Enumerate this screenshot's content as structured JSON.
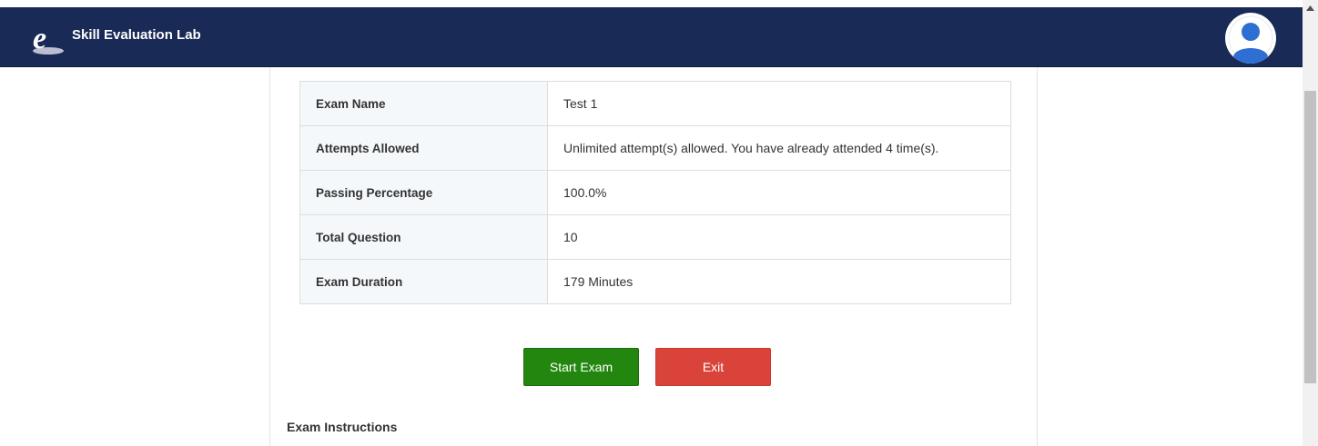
{
  "app": {
    "brand": "Skill Evaluation Lab",
    "logo_icon": "e-logo-icon",
    "avatar_icon": "user-avatar-icon"
  },
  "exam_info": {
    "rows": [
      {
        "label": "Exam Name",
        "value": "Test 1"
      },
      {
        "label": "Attempts Allowed",
        "value": "Unlimited attempt(s) allowed. You have already attended 4 time(s)."
      },
      {
        "label": "Passing Percentage",
        "value": "100.0%"
      },
      {
        "label": "Total Question",
        "value": "10"
      },
      {
        "label": "Exam Duration",
        "value": "179 Minutes"
      }
    ]
  },
  "actions": {
    "start_label": "Start Exam",
    "exit_label": "Exit"
  },
  "instructions": {
    "heading": "Exam Instructions"
  },
  "colors": {
    "navbar": "#1a2a57",
    "start_button": "#23870f",
    "exit_button": "#d9433a"
  }
}
